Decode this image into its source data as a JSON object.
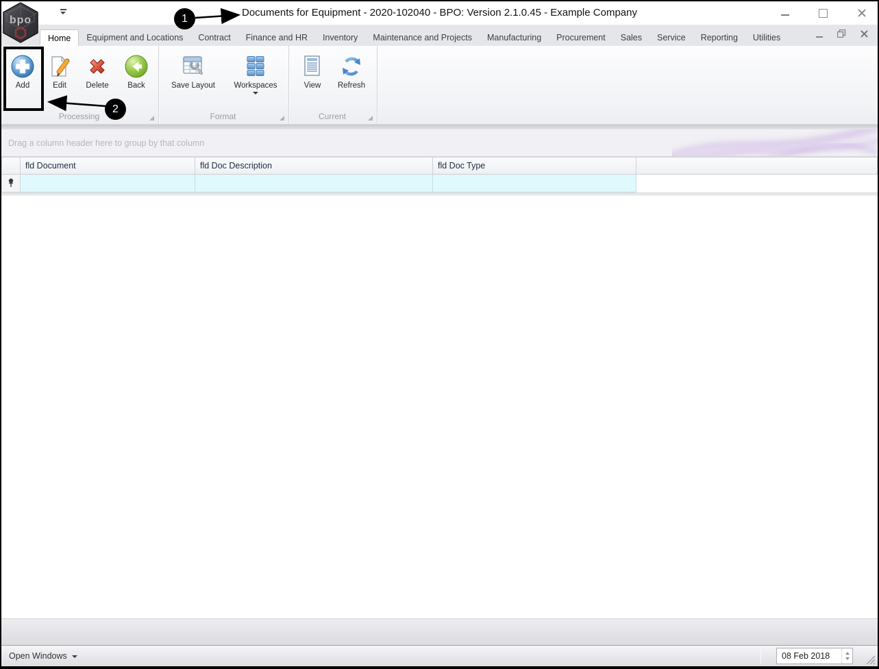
{
  "titlebar": {
    "title": "Documents for Equipment - 2020-102040 - BPO: Version 2.1.0.45 - Example Company",
    "logo_text": "bpo"
  },
  "tabs": [
    {
      "label": "Home",
      "active": true
    },
    {
      "label": "Equipment and Locations",
      "active": false
    },
    {
      "label": "Contract",
      "active": false
    },
    {
      "label": "Finance and HR",
      "active": false
    },
    {
      "label": "Inventory",
      "active": false
    },
    {
      "label": "Maintenance and Projects",
      "active": false
    },
    {
      "label": "Manufacturing",
      "active": false
    },
    {
      "label": "Procurement",
      "active": false
    },
    {
      "label": "Sales",
      "active": false
    },
    {
      "label": "Service",
      "active": false
    },
    {
      "label": "Reporting",
      "active": false
    },
    {
      "label": "Utilities",
      "active": false
    }
  ],
  "ribbon": {
    "groups": [
      {
        "label": "Processing",
        "buttons": [
          {
            "label": "Add"
          },
          {
            "label": "Edit"
          },
          {
            "label": "Delete"
          },
          {
            "label": "Back"
          }
        ]
      },
      {
        "label": "Format",
        "buttons": [
          {
            "label": "Save Layout"
          },
          {
            "label": "Workspaces",
            "has_dropdown": true
          }
        ]
      },
      {
        "label": "Current",
        "buttons": [
          {
            "label": "View"
          },
          {
            "label": "Refresh"
          }
        ]
      }
    ]
  },
  "grid": {
    "group_panel_text": "Drag a column header here to group by that column",
    "columns": [
      "fld Document",
      "fld Doc Description",
      "fld Doc Type"
    ],
    "filter_row_values": [
      "",
      "",
      ""
    ]
  },
  "status_bar": {
    "open_windows_label": "Open Windows",
    "date_value": "08 Feb 2018"
  },
  "annotations": {
    "callout1": "1",
    "callout2": "2"
  },
  "colors": {
    "annotation_black": "#000000",
    "filter_row_bg": "#dff9fd",
    "header_text": "#1d2c45",
    "add_blue": "#3376b5",
    "delete_red": "#c0392b",
    "back_green": "#76b82a",
    "icon_blue": "#5a96cc",
    "swirl_purple": "#c2a4de",
    "statusbar_text": "#333333"
  }
}
